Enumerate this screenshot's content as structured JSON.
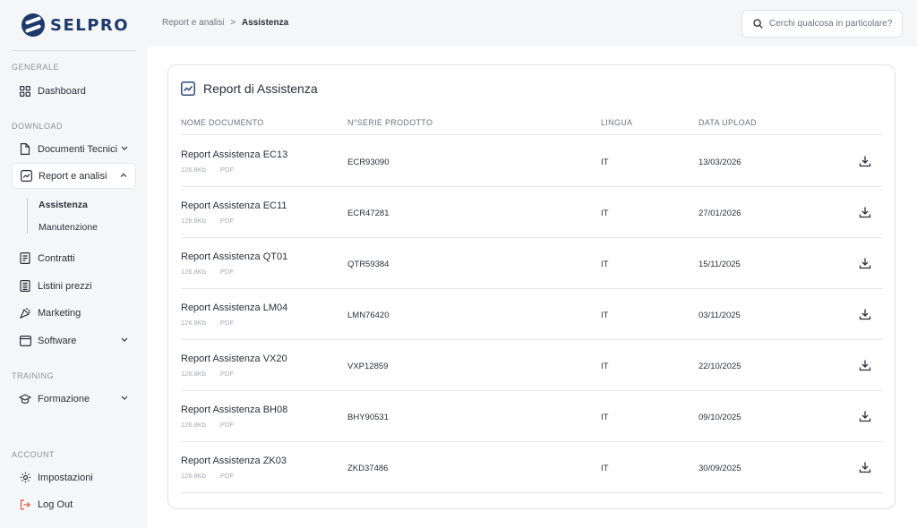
{
  "brand": {
    "name": "SELPRO"
  },
  "sidebar": {
    "sections": {
      "generale": "GENERALE",
      "download": "DOWNLOAD",
      "training": "TRAINING",
      "account": "ACCOUNT"
    },
    "items": [
      {
        "label": "Dashboard",
        "icon": "grid-icon"
      },
      {
        "label": "Documenti Tecnici",
        "icon": "document-icon"
      },
      {
        "label": "Report e analisi",
        "icon": "chart-icon"
      },
      {
        "label": "Contratti",
        "icon": "contract-icon"
      },
      {
        "label": "Listini prezzi",
        "icon": "price-list-icon"
      },
      {
        "label": "Marketing",
        "icon": "marketing-icon"
      },
      {
        "label": "Software",
        "icon": "window-icon"
      },
      {
        "label": "Formazione",
        "icon": "graduation-cap-icon"
      },
      {
        "label": "Impostazioni",
        "icon": "gear-icon"
      },
      {
        "label": "Log Out",
        "icon": "logout-icon"
      }
    ],
    "subitems": [
      {
        "label": "Assistenza"
      },
      {
        "label": "Manutenzione"
      }
    ]
  },
  "breadcrumb": {
    "parent": "Report e analisi",
    "separator": ">",
    "current": "Assistenza"
  },
  "search": {
    "placeholder": "Cerchi qualcosa in particolare?"
  },
  "card": {
    "title": "Report di Assistenza",
    "columns": [
      "NOME DOCUMENTO",
      "N°SERIE PRODOTTO",
      "LINGUA",
      "DATA UPLOAD"
    ],
    "rows": [
      {
        "name": "Report Assistenza EC13",
        "size": "126.8Kb",
        "type": ".PDF",
        "serial": "ECR93090",
        "lang": "IT",
        "date": "13/03/2026"
      },
      {
        "name": "Report Assistenza EC11",
        "size": "126.8Kb",
        "type": ".PDF",
        "serial": "ECR47281",
        "lang": "IT",
        "date": "27/01/2026"
      },
      {
        "name": "Report Assistenza QT01",
        "size": "126.8Kb",
        "type": ".PDF",
        "serial": "QTR59384",
        "lang": "IT",
        "date": "15/11/2025"
      },
      {
        "name": "Report Assistenza LM04",
        "size": "126.8Kb",
        "type": ".PDF",
        "serial": "LMN76420",
        "lang": "IT",
        "date": "03/11/2025"
      },
      {
        "name": "Report Assistenza VX20",
        "size": "126.8Kb",
        "type": ".PDF",
        "serial": "VXP12859",
        "lang": "IT",
        "date": "22/10/2025"
      },
      {
        "name": "Report Assistenza BH08",
        "size": "126.8Kb",
        "type": ".PDF",
        "serial": "BHY90531",
        "lang": "IT",
        "date": "09/10/2025"
      },
      {
        "name": "Report Assistenza ZK03",
        "size": "126.8Kb",
        "type": ".PDF",
        "serial": "ZKD37486",
        "lang": "IT",
        "date": "30/09/2025"
      }
    ]
  },
  "colors": {
    "brand": "#1d3a6b",
    "logout_accent": "#e05a3a",
    "border": "#dfe2e7"
  }
}
